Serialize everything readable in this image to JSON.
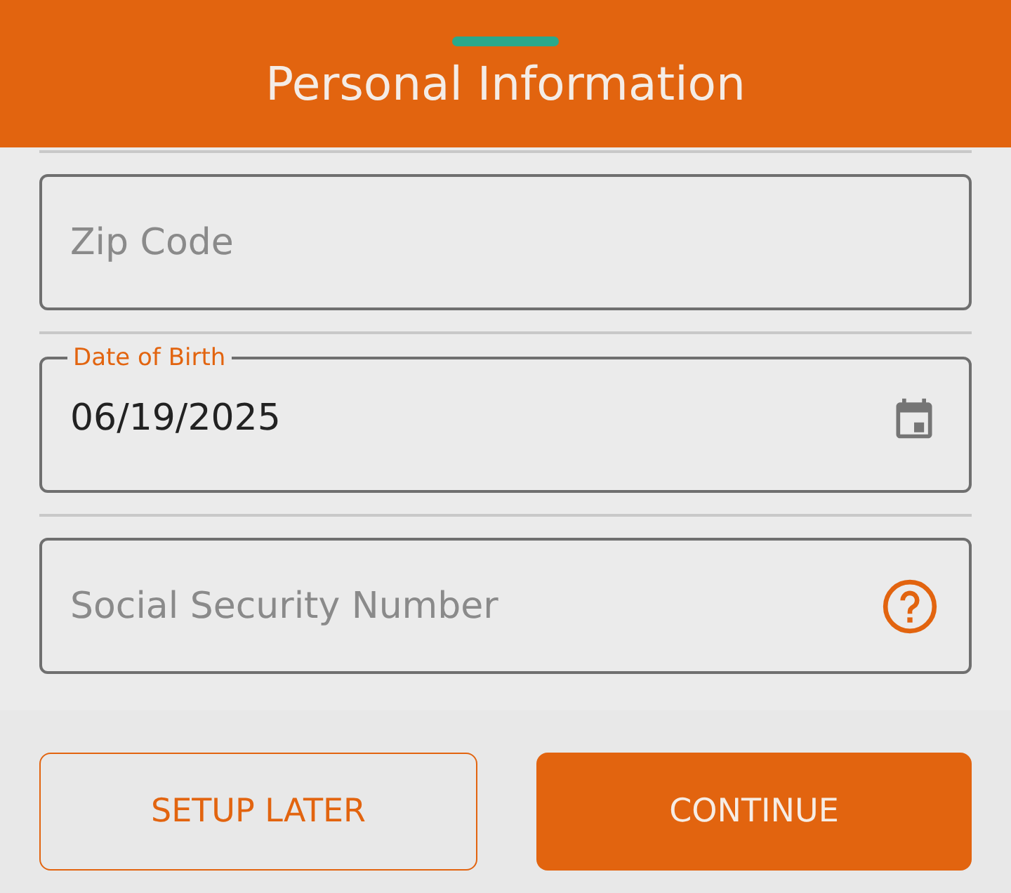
{
  "header": {
    "title": "Personal Information"
  },
  "fields": [
    {
      "kind": "text",
      "placeholder": "Zip Code"
    },
    {
      "kind": "date",
      "label": "Date of Birth",
      "value": "06/19/2025"
    },
    {
      "kind": "help",
      "placeholder": "Social Security Number"
    }
  ],
  "buttons": [
    {
      "kind": "outline",
      "label": "SETUP LATER"
    },
    {
      "kind": "filled",
      "label": "CONTINUE"
    }
  ]
}
